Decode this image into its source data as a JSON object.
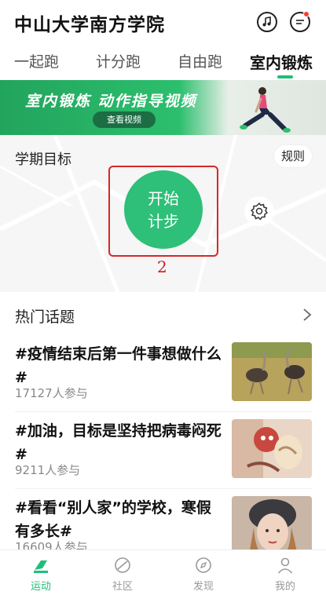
{
  "header": {
    "title": "中山大学南方学院",
    "icons": [
      "music-icon",
      "message-icon"
    ]
  },
  "tabs": [
    {
      "label": "一起跑"
    },
    {
      "label": "计分跑"
    },
    {
      "label": "自由跑"
    },
    {
      "label": "室内锻炼",
      "active": true
    }
  ],
  "banner": {
    "title": "室内锻炼  动作指导视频",
    "button": "查看视频"
  },
  "goal": {
    "title": "学期目标",
    "rules": "规则",
    "start_line1": "开始",
    "start_line2": "计步",
    "annotation": "2"
  },
  "topics": {
    "title": "热门话题",
    "items": [
      {
        "title": "#疫情结束后第一件事想做什么#",
        "count": "17127人参与"
      },
      {
        "title": "#加油，目标是坚持把病毒闷死#",
        "count": "9211人参与"
      },
      {
        "title": "#看看“别人家”的学校，寒假有多长#",
        "count": "16609人参与"
      }
    ]
  },
  "nav": [
    {
      "label": "运动",
      "active": true
    },
    {
      "label": "社区"
    },
    {
      "label": "发现"
    },
    {
      "label": "我的"
    }
  ],
  "colors": {
    "accent": "#1fbf7a",
    "start_button": "#2ebf79",
    "annotation": "#d62828"
  }
}
